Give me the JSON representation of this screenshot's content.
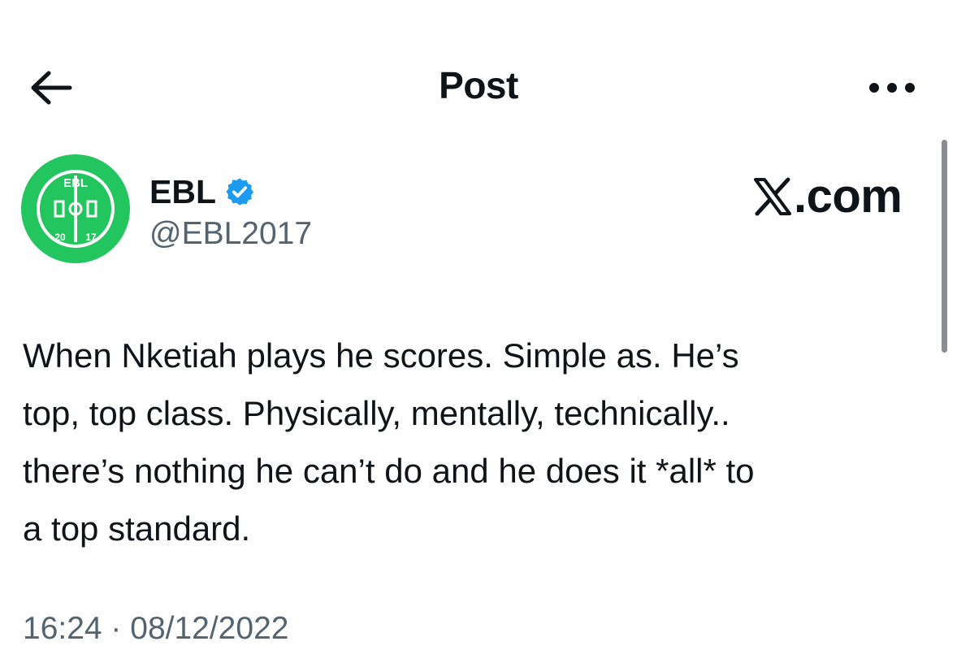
{
  "header": {
    "title": "Post",
    "back_icon": "arrow-left-icon",
    "more_icon": "more-horizontal-icon"
  },
  "author": {
    "display_name": "EBL",
    "handle": "@EBL2017",
    "verified": true,
    "verified_color": "#1d9bf0",
    "avatar": {
      "background": "#22c55e",
      "logo_text_top": "EBL",
      "logo_text_left": "20",
      "logo_text_right": "17"
    }
  },
  "watermark": {
    "x_glyph": "𝕏",
    "suffix": ".com"
  },
  "post": {
    "text": "When Nketiah plays he scores. Simple as. He’s\ntop, top class. Physically, mentally, technically..\nthere’s nothing he can’t do and he does it *all* to\na top standard.",
    "timestamp": "16:24 · 08/12/2022"
  },
  "colors": {
    "text_primary": "#0f1419",
    "text_secondary": "#536471",
    "background": "#ffffff"
  }
}
